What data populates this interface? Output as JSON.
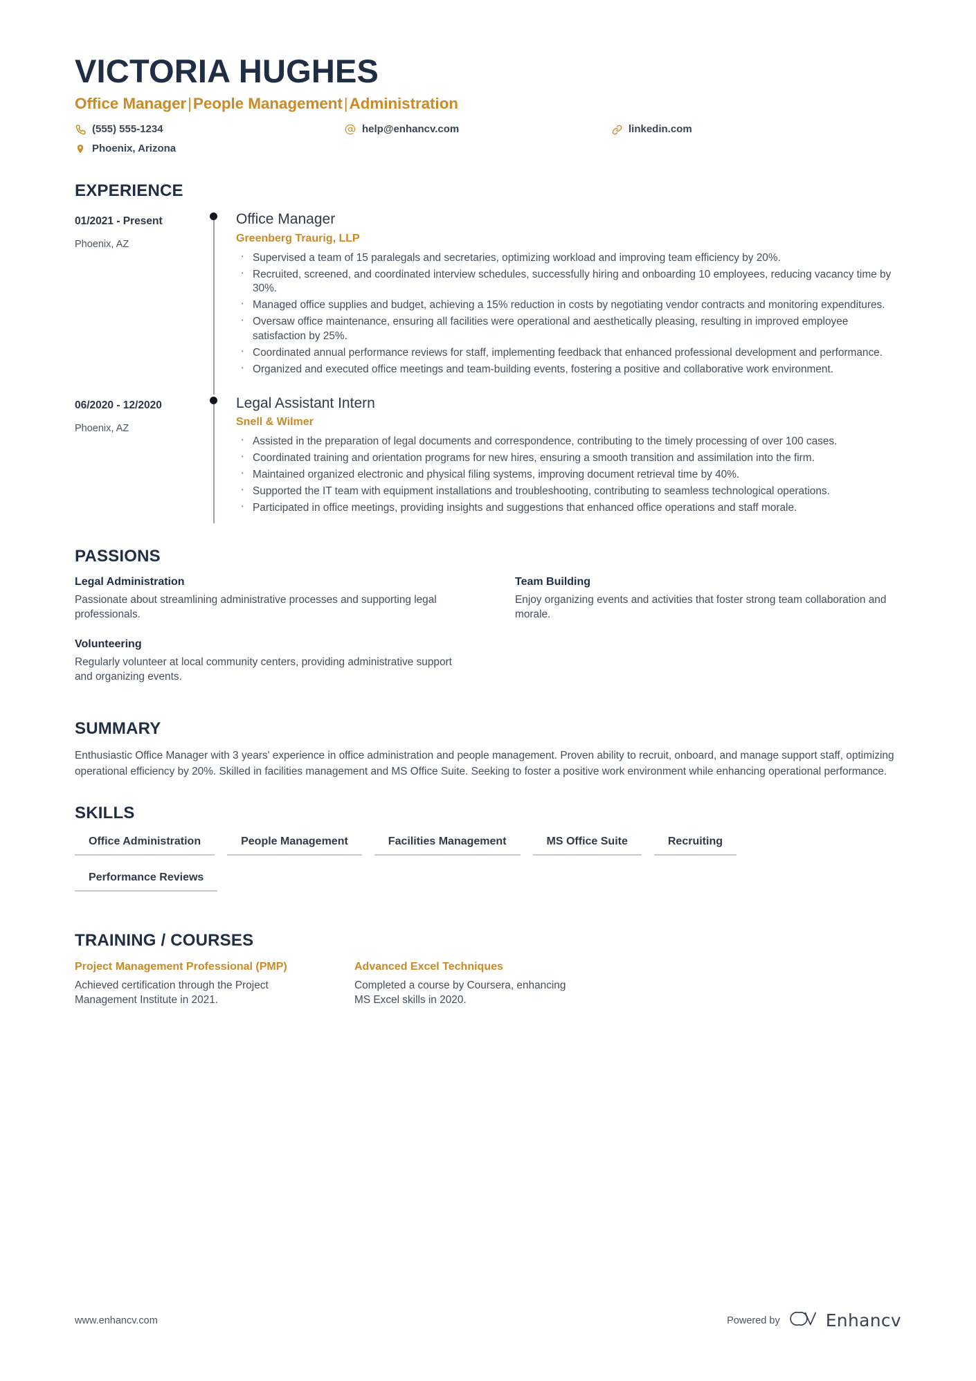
{
  "colors": {
    "accent": "#c98a28",
    "dark": "#1f2e45",
    "body": "#434d5d",
    "rule": "#c4c8cf"
  },
  "header": {
    "name": "VICTORIA HUGHES",
    "headline_parts": [
      "Office Manager",
      "People Management",
      "Administration"
    ],
    "headline_separator": "|",
    "contacts": [
      {
        "icon": "phone-icon",
        "value": "(555) 555-1234"
      },
      {
        "icon": "email-icon",
        "value": "help@enhancv.com"
      },
      {
        "icon": "link-icon",
        "value": "linkedin.com"
      },
      {
        "icon": "location-icon",
        "value": "Phoenix, Arizona"
      }
    ]
  },
  "sections": {
    "experience": {
      "title": "EXPERIENCE",
      "entries": [
        {
          "date": "01/2021 - Present",
          "location": "Phoenix, AZ",
          "role": "Office Manager",
          "company": "Greenberg Traurig, LLP",
          "bullets": [
            "Supervised a team of 15 paralegals and secretaries, optimizing workload and improving team efficiency by 20%.",
            "Recruited, screened, and coordinated interview schedules, successfully hiring and onboarding 10 employees, reducing vacancy time by 30%.",
            "Managed office supplies and budget, achieving a 15% reduction in costs by negotiating vendor contracts and monitoring expenditures.",
            "Oversaw office maintenance, ensuring all facilities were operational and aesthetically pleasing, resulting in improved employee satisfaction by 25%.",
            "Coordinated annual performance reviews for staff, implementing feedback that enhanced professional development and performance.",
            "Organized and executed office meetings and team-building events, fostering a positive and collaborative work environment."
          ]
        },
        {
          "date": "06/2020 - 12/2020",
          "location": "Phoenix, AZ",
          "role": "Legal Assistant Intern",
          "company": "Snell & Wilmer",
          "bullets": [
            "Assisted in the preparation of legal documents and correspondence, contributing to the timely processing of over 100 cases.",
            "Coordinated training and orientation programs for new hires, ensuring a smooth transition and assimilation into the firm.",
            "Maintained organized electronic and physical filing systems, improving document retrieval time by 40%.",
            "Supported the IT team with equipment installations and troubleshooting, contributing to seamless technological operations.",
            "Participated in office meetings, providing insights and suggestions that enhanced office operations and staff morale."
          ]
        }
      ]
    },
    "passions": {
      "title": "PASSIONS",
      "items": [
        {
          "title": "Legal Administration",
          "text": "Passionate about streamlining administrative processes and supporting legal professionals."
        },
        {
          "title": "Team Building",
          "text": "Enjoy organizing events and activities that foster strong team collaboration and morale."
        },
        {
          "title": "Volunteering",
          "text": "Regularly volunteer at local community centers, providing administrative support and organizing events."
        }
      ]
    },
    "summary": {
      "title": "SUMMARY",
      "text": "Enthusiastic Office Manager with 3 years' experience in office administration and people management. Proven ability to recruit, onboard, and manage support staff, optimizing operational efficiency by 20%. Skilled in facilities management and MS Office Suite. Seeking to foster a positive work environment while enhancing operational performance."
    },
    "skills": {
      "title": "SKILLS",
      "items": [
        "Office Administration",
        "People Management",
        "Facilities Management",
        "MS Office Suite",
        "Recruiting",
        "Performance Reviews"
      ]
    },
    "training": {
      "title": "TRAINING / COURSES",
      "items": [
        {
          "title": "Project Management Professional (PMP)",
          "text": "Achieved certification through the Project Management Institute in 2021."
        },
        {
          "title": "Advanced Excel Techniques",
          "text": "Completed a course by Coursera, enhancing MS Excel skills in 2020."
        }
      ]
    }
  },
  "footer": {
    "url": "www.enhancv.com",
    "powered_by": "Powered by",
    "brand": "Enhancv"
  }
}
